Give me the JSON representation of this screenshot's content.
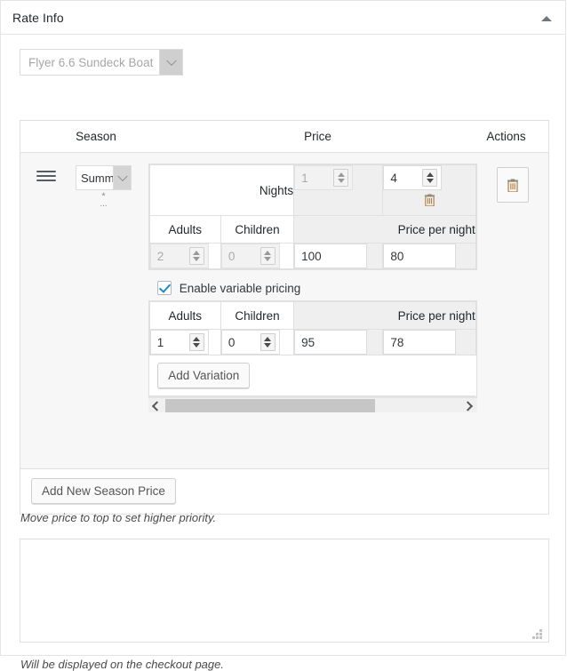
{
  "panel": {
    "title": "Rate Info",
    "collapse_icon": "triangle-up-icon"
  },
  "boat_select": {
    "value": "Flyer 6.6 Sundeck Boat",
    "icon": "chevron-down-icon"
  },
  "season_table": {
    "headers": {
      "season": "Season",
      "price": "Price",
      "actions": "Actions"
    },
    "row": {
      "drag_handle_icon": "drag-handle-icon",
      "season_value": "Summ",
      "season_required_mark": "*",
      "season_required_dots": "...",
      "delete_icon": "trash-icon"
    }
  },
  "price_table": {
    "nights_label": "Nights",
    "adults_label": "Adults",
    "children_label": "Children",
    "price_per_night_label": "Price per night",
    "nights_from": "1",
    "nights_to": "4",
    "nights_delete_icon": "trash-icon",
    "adults": "2",
    "children": "0",
    "price_1": "100",
    "price_2": "80"
  },
  "variable_pricing": {
    "checkbox_label": "Enable variable pricing",
    "checked": true,
    "adults_label": "Adults",
    "children_label": "Children",
    "price_per_night_label": "Price per night",
    "adults": "1",
    "children": "0",
    "price_1": "95",
    "price_2": "78",
    "add_variation_label": "Add Variation"
  },
  "scrollbar": {
    "left_arrow_icon": "chevron-left-icon",
    "right_arrow_icon": "chevron-right-icon"
  },
  "footer": {
    "add_new_season_label": "Add New Season Price",
    "priority_hint": "Move price to top to set higher priority.",
    "checkout_hint": "Will be displayed on the checkout page."
  },
  "description": {
    "value": "",
    "placeholder": ""
  },
  "colors": {
    "accent": "#1e8cbe",
    "border": "#e0e0e0",
    "row_bg": "#f7f7f7",
    "cell_grey": "#efefef"
  }
}
